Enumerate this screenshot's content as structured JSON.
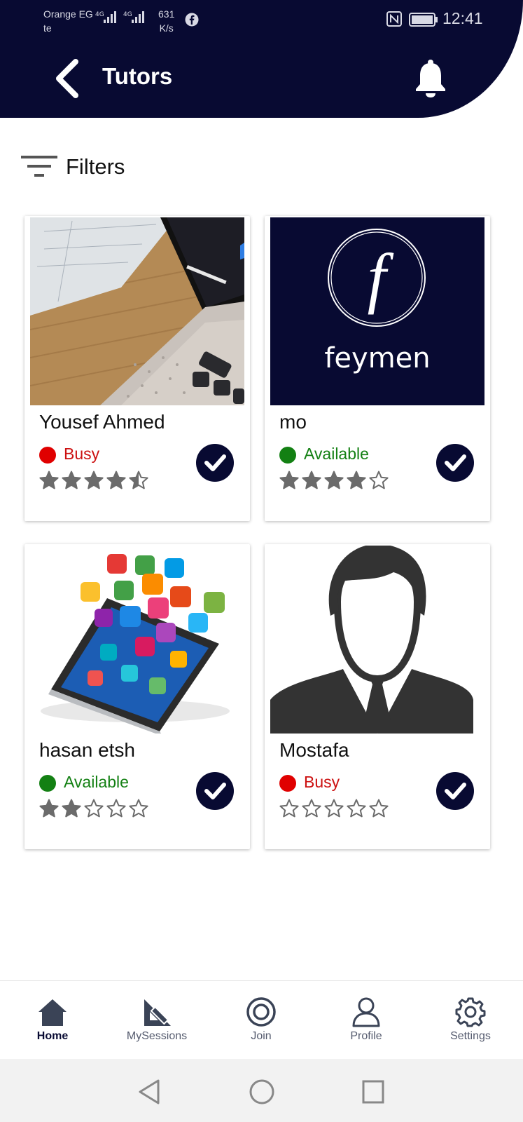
{
  "status_bar": {
    "carrier_line1": "Orange EG",
    "carrier_line2": "te",
    "network": "4G 4G",
    "speed_value": "631",
    "speed_unit": "K/s",
    "time": "12:41"
  },
  "header": {
    "title": "Tutors"
  },
  "filters": {
    "label": "Filters"
  },
  "colors": {
    "primary": "#080a32",
    "busy": "#e00000",
    "busy_text": "#cc1010",
    "available": "#138013",
    "star": "#6b6b6b"
  },
  "tutors": [
    {
      "name": "Yousef Ahmed",
      "status": "Busy",
      "rating": 4.5
    },
    {
      "name": "mo",
      "status": "Available",
      "rating": 4
    },
    {
      "name": "hasan etsh",
      "status": "Available",
      "rating": 2
    },
    {
      "name": "Mostafa",
      "status": "Busy",
      "rating": 0
    }
  ],
  "tutor_images": {
    "card0": "laptop-photo",
    "card1": "feymen-logo",
    "card2": "phone-apps-image",
    "card3": "avatar-silhouette",
    "logo_text": "feymen",
    "logo_letter": "f"
  },
  "bottom_nav": [
    {
      "label": "Home",
      "icon": "home-icon",
      "active": true
    },
    {
      "label": "MySessions",
      "icon": "set-square-icon",
      "active": false
    },
    {
      "label": "Join",
      "icon": "join-circle-icon",
      "active": false
    },
    {
      "label": "Profile",
      "icon": "profile-icon",
      "active": false
    },
    {
      "label": "Settings",
      "icon": "gear-icon",
      "active": false
    }
  ]
}
